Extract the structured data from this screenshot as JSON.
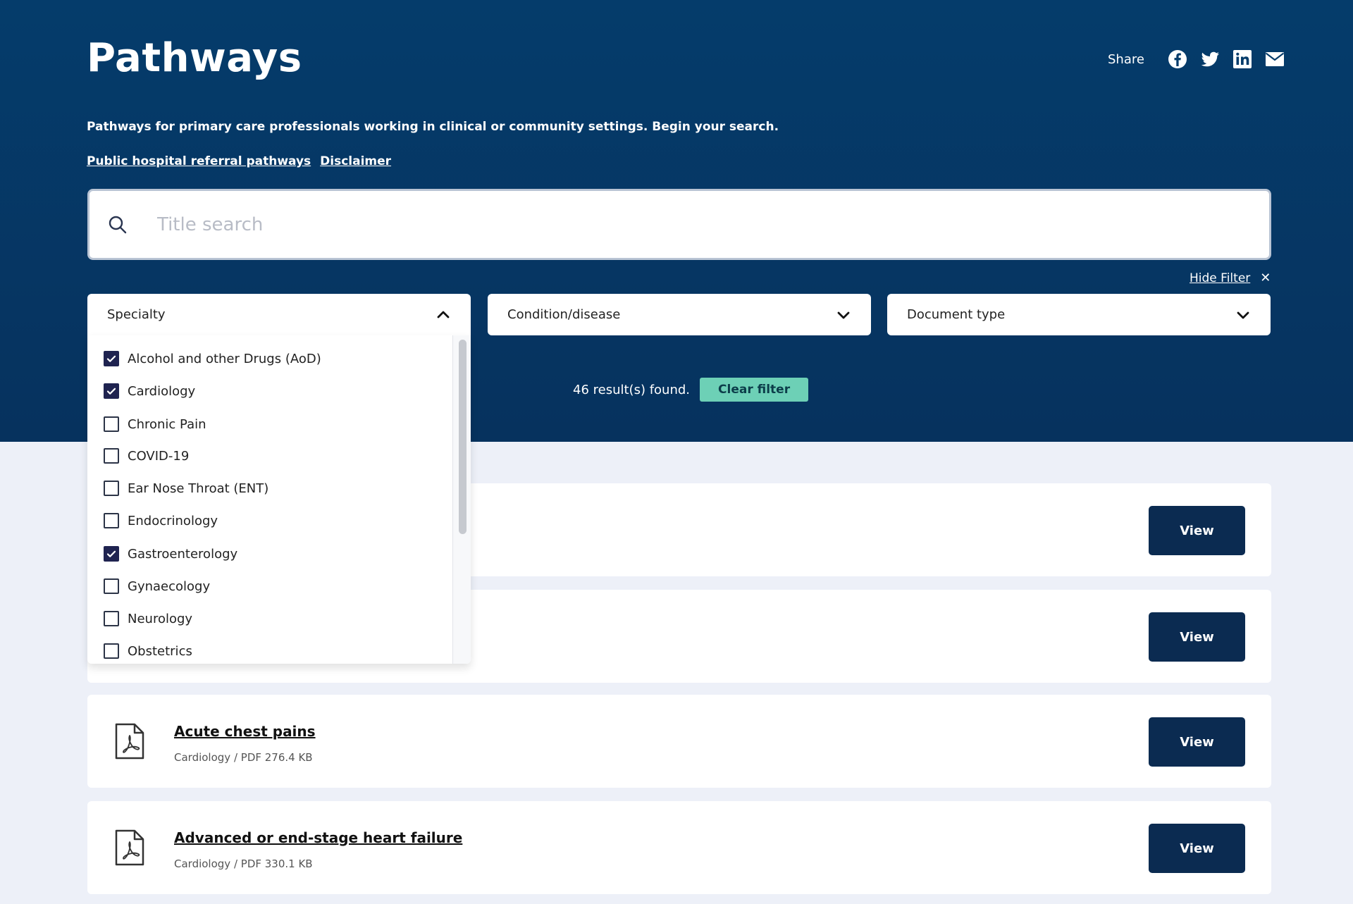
{
  "header": {
    "title": "Pathways",
    "share_label": "Share",
    "share_icons": [
      "facebook-icon",
      "twitter-icon",
      "linkedin-icon",
      "email-icon"
    ],
    "intro": "Pathways for primary care professionals working in clinical or community settings. Begin your search.",
    "links": [
      "Public hospital referral pathways",
      "Disclaimer"
    ]
  },
  "search": {
    "placeholder": "Title search",
    "value": ""
  },
  "filters": {
    "hide_label": "Hide Filter",
    "specialty": {
      "label": "Specialty",
      "expanded": true,
      "options": [
        {
          "label": "Alcohol and other Drugs (AoD)",
          "checked": true
        },
        {
          "label": "Cardiology",
          "checked": true
        },
        {
          "label": "Chronic Pain",
          "checked": false
        },
        {
          "label": "COVID-19",
          "checked": false
        },
        {
          "label": "Ear Nose Throat (ENT)",
          "checked": false
        },
        {
          "label": "Endocrinology",
          "checked": false
        },
        {
          "label": "Gastroenterology",
          "checked": true
        },
        {
          "label": "Gynaecology",
          "checked": false
        },
        {
          "label": "Neurology",
          "checked": false
        },
        {
          "label": "Obstetrics",
          "checked": false
        }
      ]
    },
    "condition": {
      "label": "Condition/disease"
    },
    "doctype": {
      "label": "Document type"
    }
  },
  "results": {
    "text": "46 result(s) found.",
    "clear_label": "Clear filter"
  },
  "cards": [
    {
      "title": "",
      "meta": "",
      "view_label": "View"
    },
    {
      "title": "",
      "meta": "",
      "view_label": "View"
    },
    {
      "title": "Acute chest pains",
      "meta": "Cardiology / PDF 276.4 KB",
      "view_label": "View"
    },
    {
      "title": "Advanced or end-stage heart failure",
      "meta": "Cardiology / PDF 330.1 KB",
      "view_label": "View"
    }
  ],
  "colors": {
    "hero_bg": "#053c6b",
    "page_bg": "#edf0f8",
    "accent_button": "#0b2b51",
    "clear_filter": "#6dd0b6",
    "checkbox_checked": "#1f2350"
  }
}
